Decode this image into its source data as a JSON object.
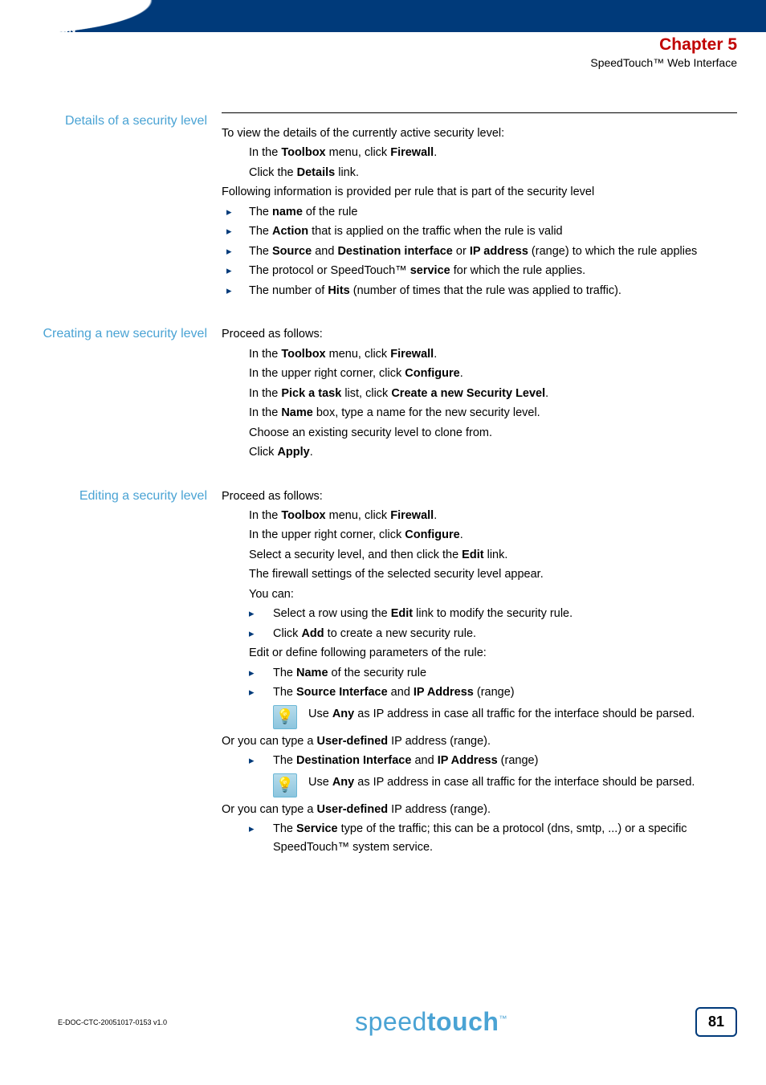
{
  "header": {
    "logo_text": "THOMSON",
    "chapter": "Chapter 5",
    "subtitle": "SpeedTouch™ Web Interface"
  },
  "sections": {
    "s1": {
      "heading": "Details of a security level",
      "intro": "To view the details of the currently active security level:",
      "step1_a": "In the ",
      "step1_b": "Toolbox",
      "step1_c": " menu, click ",
      "step1_d": "Firewall",
      "step1_e": ".",
      "step2_a": "Click the ",
      "step2_b": "Details",
      "step2_c": " link.",
      "follow": "Following information is provided per rule that is part of the security level",
      "b1_a": "The ",
      "b1_b": "name",
      "b1_c": " of the rule",
      "b2_a": "The ",
      "b2_b": "Action",
      "b2_c": " that is applied on the traffic when the rule is valid",
      "b3_a": "The ",
      "b3_b": "Source",
      "b3_c": " and ",
      "b3_d": "Destination interface",
      "b3_e": " or ",
      "b3_f": "IP address",
      "b3_g": " (range) to which the rule applies",
      "b4_a": "The protocol or SpeedTouch™ ",
      "b4_b": "service",
      "b4_c": " for which the rule applies.",
      "b5_a": "The number of ",
      "b5_b": "Hits",
      "b5_c": " (number of times that the rule was applied to traffic)."
    },
    "s2": {
      "heading": "Creating a new security level",
      "intro": "Proceed as follows:",
      "l1_a": "In the ",
      "l1_b": "Toolbox",
      "l1_c": " menu, click ",
      "l1_d": "Firewall",
      "l1_e": ".",
      "l2_a": "In the upper right corner, click ",
      "l2_b": "Configure",
      "l2_c": ".",
      "l3_a": "In the ",
      "l3_b": "Pick a task",
      "l3_c": " list, click ",
      "l3_d": "Create a new Security Level",
      "l3_e": ".",
      "l4_a": "In the ",
      "l4_b": "Name",
      "l4_c": " box, type a name for the new security level.",
      "l5": "Choose an existing security level to clone from.",
      "l6_a": "Click ",
      "l6_b": "Apply",
      "l6_c": "."
    },
    "s3": {
      "heading": "Editing a security level",
      "intro": "Proceed as follows:",
      "l1_a": "In the ",
      "l1_b": "Toolbox",
      "l1_c": " menu, click ",
      "l1_d": "Firewall",
      "l1_e": ".",
      "l2_a": "In the upper right corner, click ",
      "l2_b": "Configure",
      "l2_c": ".",
      "l3_a": "Select a security level, and then click the ",
      "l3_b": "Edit",
      "l3_c": " link.",
      "l4": "The firewall settings of the selected security level appear.",
      "l5": "You can:",
      "sub1_a": "Select a row using the ",
      "sub1_b": "Edit",
      "sub1_c": " link to modify the security rule.",
      "sub2_a": "Click ",
      "sub2_b": "Add",
      "sub2_c": " to create a new security rule.",
      "l6": "Edit or define following parameters of the rule:",
      "p1_a": "The ",
      "p1_b": "Name",
      "p1_c": " of the security rule",
      "p2_a": "The ",
      "p2_b": "Source Interface",
      "p2_c": " and ",
      "p2_d": "IP Address",
      "p2_e": " (range)",
      "tip1_a": "Use ",
      "tip1_b": "Any",
      "tip1_c": " as IP address in case all traffic for the interface should be parsed.",
      "p2_after_a": "Or you can type a ",
      "p2_after_b": "User-defined",
      "p2_after_c": " IP address (range).",
      "p3_a": "The ",
      "p3_b": "Destination Interface",
      "p3_c": " and ",
      "p3_d": "IP Address",
      "p3_e": " (range)",
      "tip2_a": "Use ",
      "tip2_b": "Any",
      "tip2_c": " as IP address in case all traffic for the interface should be parsed.",
      "p3_after_a": "Or you can type a ",
      "p3_after_b": "User-defined",
      "p3_after_c": " IP address (range).",
      "p4_a": "The ",
      "p4_b": "Service",
      "p4_c": " type of the traffic; this can be a protocol (dns, smtp, ...) or a specific SpeedTouch™ system service."
    }
  },
  "footer": {
    "doc_id": "E-DOC-CTC-20051017-0153 v1.0",
    "brand_a": "speed",
    "brand_b": "touch",
    "page": "81"
  }
}
